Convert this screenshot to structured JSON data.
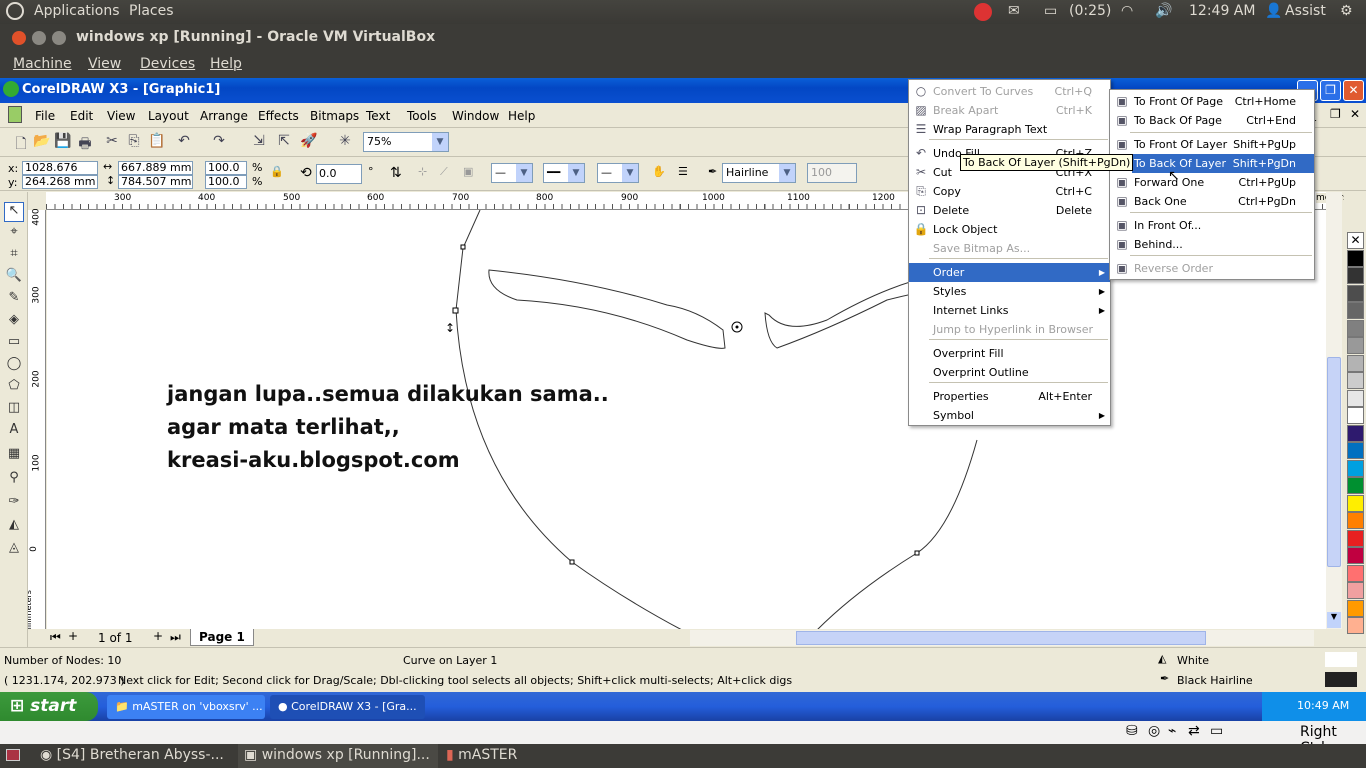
{
  "ubuntu_top": {
    "apps": "Applications",
    "places": "Places",
    "battery": "(0:25)",
    "time": "12:49 AM",
    "user": "Assist"
  },
  "vbox": {
    "title": "windows xp [Running] - Oracle VM VirtualBox",
    "menu": [
      "Machine",
      "View",
      "Devices",
      "Help"
    ],
    "host_key": "Right Ctrl"
  },
  "corel": {
    "title": "CorelDRAW X3 - [Graphic1]",
    "menu": [
      "File",
      "Edit",
      "View",
      "Layout",
      "Arrange",
      "Effects",
      "Bitmaps",
      "Text",
      "Tools",
      "Window",
      "Help"
    ],
    "zoom": "75%",
    "props": {
      "x_label": "x:",
      "y_label": "y:",
      "x": "1028.676 mm",
      "y": "264.268 mm",
      "w": "667.889 mm",
      "h": "784.507 mm",
      "sx": "100.0",
      "sy": "100.0",
      "pct": "%",
      "angle": "0.0",
      "deg": "°",
      "outline": "Hairline",
      "opacity": "100"
    },
    "ruler_top": [
      "300",
      "400",
      "500",
      "600",
      "700",
      "800",
      "900",
      "1000",
      "1100",
      "1200"
    ],
    "ruler_left": [
      "400",
      "300",
      "200",
      "100",
      "0"
    ],
    "ruler_unit": "millimeters",
    "dockers_label": "meters",
    "canvas_text": [
      "jangan lupa..semua dilakukan sama..",
      "agar mata terlihat,,",
      "kreasi-aku.blogspot.com"
    ],
    "page_nav": {
      "count": "1 of 1",
      "tab": "Page 1"
    },
    "status": {
      "nodes": "Number of Nodes: 10",
      "object": "Curve on Layer 1",
      "coords": "( 1231.174, 202.973 )",
      "hint": "Next click for Edit; Second click for Drag/Scale; Dbl-clicking tool selects all objects; Shift+click multi-selects; Alt+click digs",
      "fill": "White",
      "outline": "Black  Hairline"
    },
    "palette": [
      "#ffffff",
      "#000000",
      "#333333",
      "#4d4d4d",
      "#666666",
      "#808080",
      "#999999",
      "#b3b3b3",
      "#cccccc",
      "#e6e6e6",
      "#ffffff",
      "#2e1a6e",
      "#0070c0",
      "#00a0e0",
      "#009030",
      "#ffee00",
      "#ff8000",
      "#e82020",
      "#c00040",
      "#ff7070",
      "#f0a0a0",
      "#ff9a00",
      "#ffb090"
    ]
  },
  "context_menu": [
    {
      "label": "Convert To Curves",
      "shortcut": "Ctrl+Q",
      "disabled": true,
      "icon": "convert-curves-icon"
    },
    {
      "label": "Break  Apart",
      "shortcut": "Ctrl+K",
      "disabled": true,
      "icon": "break-apart-icon"
    },
    {
      "label": "Wrap Paragraph Text",
      "shortcut": "",
      "icon": "wrap-text-icon"
    },
    {
      "label": "Undo Fill",
      "shortcut": "Ctrl+Z",
      "icon": "undo-icon"
    },
    {
      "label": "Cut",
      "shortcut": "Ctrl+X",
      "icon": "cut-icon"
    },
    {
      "label": "Copy",
      "shortcut": "Ctrl+C",
      "icon": "copy-icon"
    },
    {
      "label": "Delete",
      "shortcut": "Delete",
      "icon": "delete-icon"
    },
    {
      "label": "Lock Object",
      "shortcut": "",
      "icon": "lock-icon"
    },
    {
      "label": "Save Bitmap As...",
      "shortcut": "",
      "disabled": true
    },
    {
      "label": "Order",
      "submenu": true,
      "highlighted": true
    },
    {
      "label": "Styles",
      "submenu": true
    },
    {
      "label": "Internet Links",
      "submenu": true
    },
    {
      "label": "Jump to Hyperlink in Browser",
      "disabled": true
    },
    {
      "label": "Overprint Fill"
    },
    {
      "label": "Overprint Outline"
    },
    {
      "label": "Properties",
      "shortcut": "Alt+Enter"
    },
    {
      "label": "Symbol",
      "submenu": true
    }
  ],
  "order_submenu": [
    {
      "label": "To Front Of Page",
      "shortcut": "Ctrl+Home"
    },
    {
      "label": "To Back Of Page",
      "shortcut": "Ctrl+End"
    },
    {
      "label": "To Front Of Layer",
      "shortcut": "Shift+PgUp"
    },
    {
      "label": "To Back Of Layer",
      "shortcut": "Shift+PgDn",
      "highlighted": true
    },
    {
      "label": "Forward One",
      "shortcut": "Ctrl+PgUp"
    },
    {
      "label": "Back One",
      "shortcut": "Ctrl+PgDn"
    },
    {
      "label": "In Front Of...",
      "shortcut": ""
    },
    {
      "label": "Behind...",
      "shortcut": ""
    },
    {
      "label": "Reverse Order",
      "shortcut": "",
      "disabled": true
    }
  ],
  "tooltip": "To Back Of Layer (Shift+PgDn)",
  "xp_taskbar": {
    "start": "start",
    "tasks": [
      "mASTER on 'vboxsrv' ...",
      "CorelDRAW X3 - [Gra..."
    ],
    "time": "10:49 AM"
  },
  "ubuntu_bottom": {
    "tasks": [
      "[S4] Bretheran Abyss-...",
      "windows xp [Running]...",
      "mASTER"
    ]
  }
}
